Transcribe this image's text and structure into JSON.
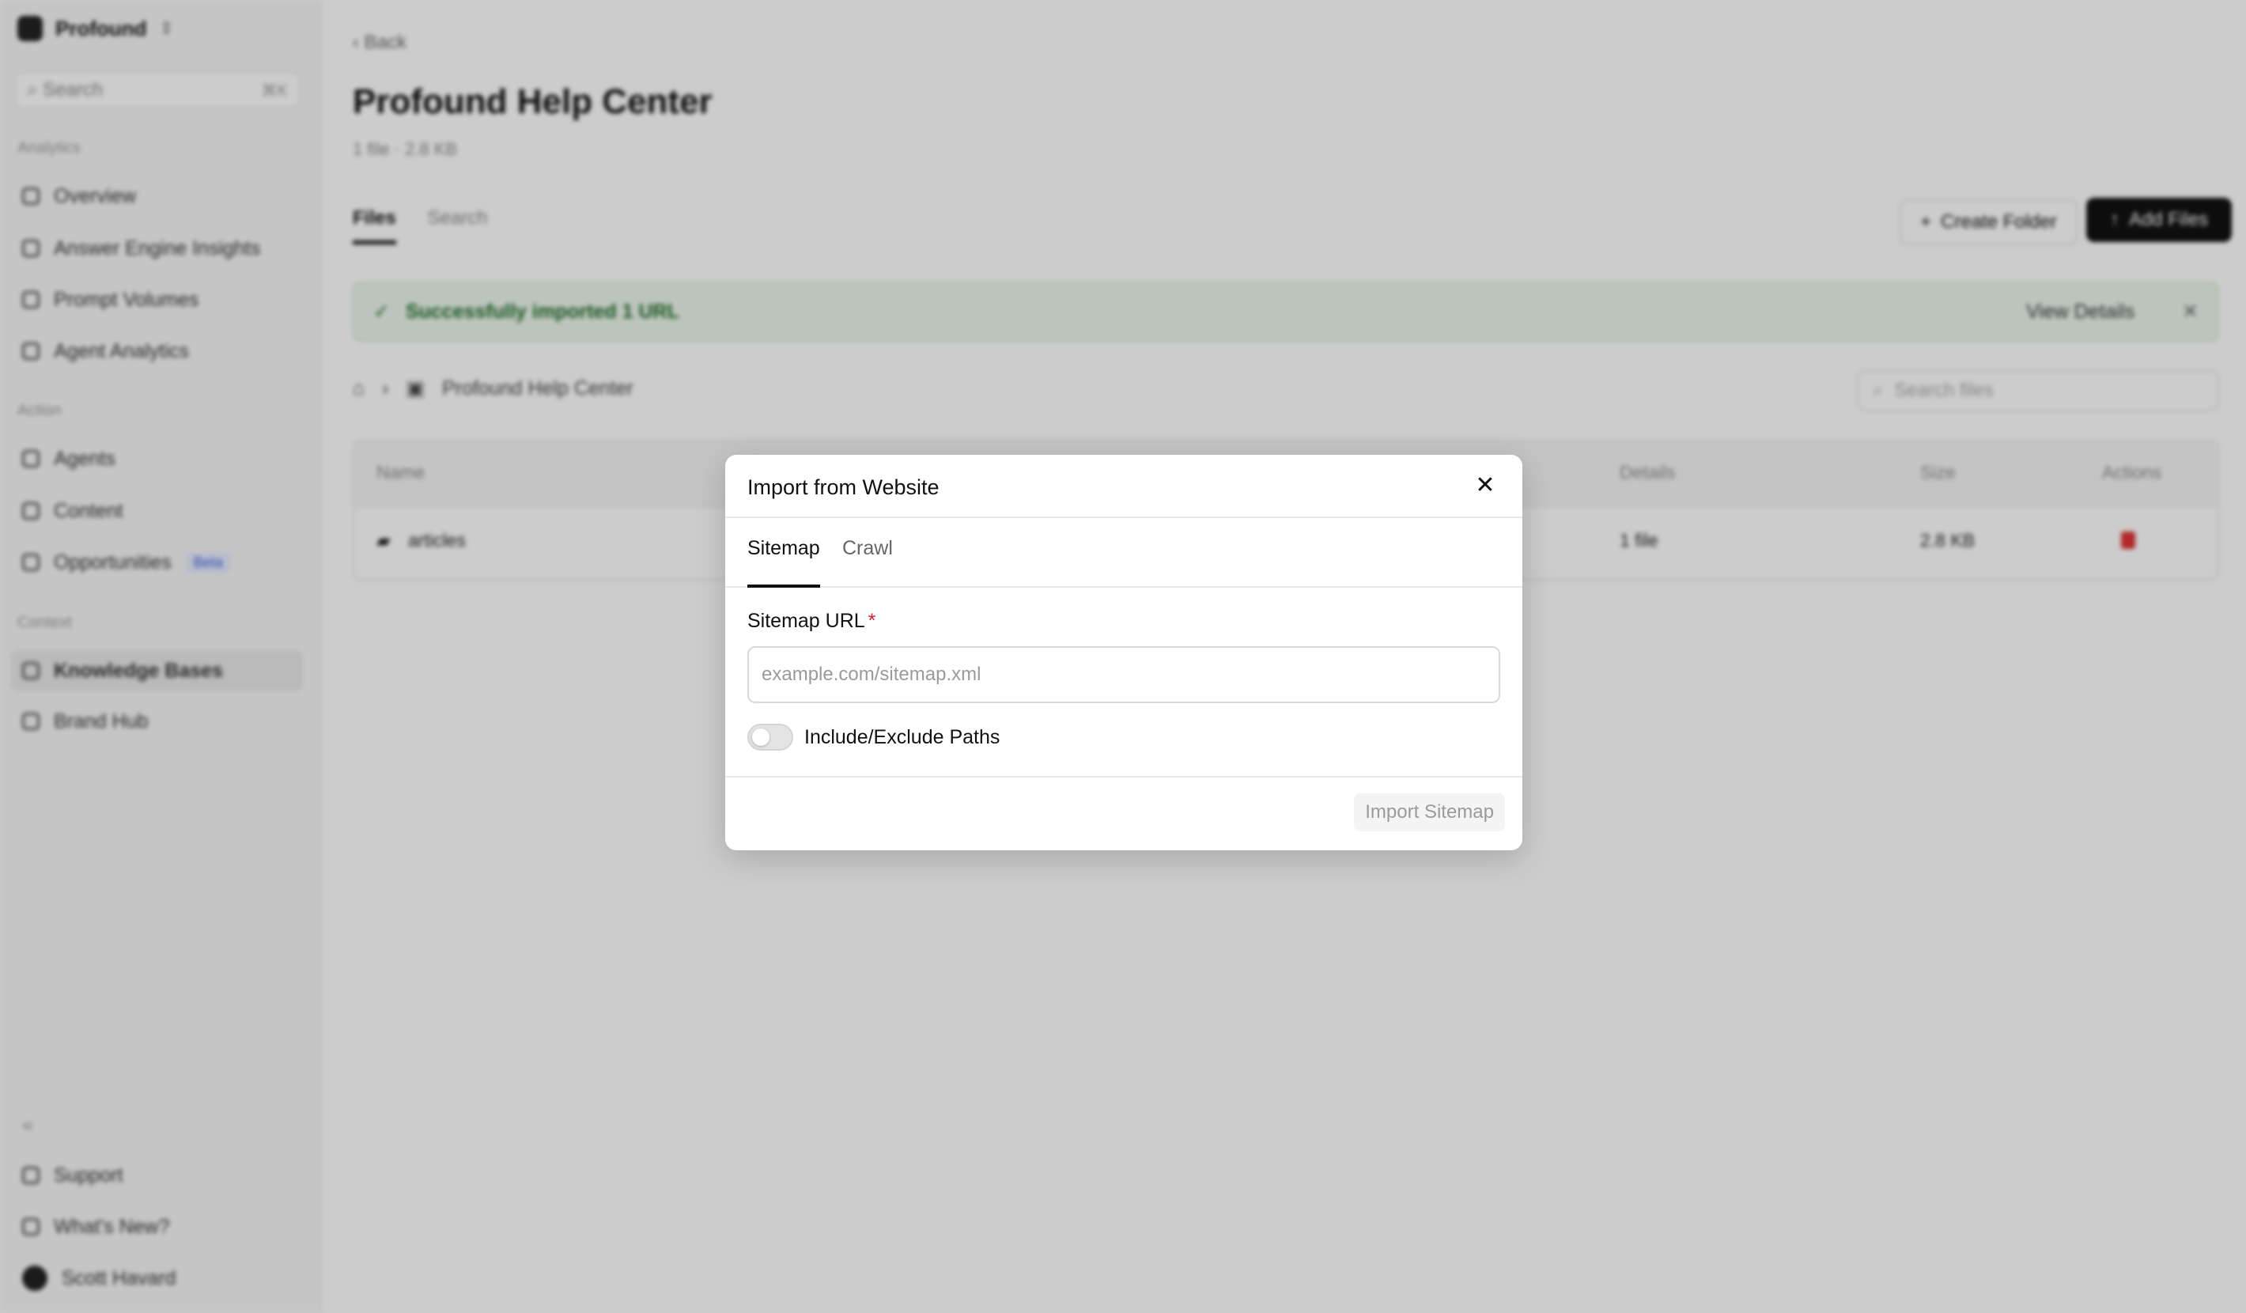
{
  "sidebar": {
    "org_name": "Profound",
    "search_placeholder": "Search",
    "search_shortcut": "⌘K",
    "sections": [
      {
        "label": "Analytics",
        "items": [
          "Overview",
          "Answer Engine Insights",
          "Prompt Volumes",
          "Agent Analytics"
        ]
      },
      {
        "label": "Action",
        "items": [
          "Agents",
          "Content",
          "Opportunities"
        ]
      },
      {
        "label": "Context",
        "items": [
          "Knowledge Bases",
          "Brand Hub"
        ]
      }
    ],
    "opportunities_badge": "Beta",
    "footer": {
      "collapse": "«",
      "support": "Support",
      "whats_new": "What's New?",
      "user": "Scott Havard"
    }
  },
  "main": {
    "back": "Back",
    "title": "Profound Help Center",
    "subtitle": "1 file · 2.8 KB",
    "tabs": [
      "Files",
      "Search"
    ],
    "create_folder": "Create Folder",
    "add_files": "Add Files",
    "banner": {
      "message": "Successfully imported 1 URL",
      "view_details": "View Details"
    },
    "breadcrumb": "Profound Help Center",
    "search_files_placeholder": "Search files",
    "table": {
      "headers": [
        "Name",
        "Details",
        "Size",
        "Actions"
      ],
      "rows": [
        {
          "name": "articles",
          "details": "1 file",
          "size": "2.8 KB"
        }
      ]
    }
  },
  "modal": {
    "title": "Import from Website",
    "tabs": [
      "Sitemap",
      "Crawl"
    ],
    "active_tab": "Sitemap",
    "field_label": "Sitemap URL",
    "required_marker": "*",
    "input_placeholder": "example.com/sitemap.xml",
    "input_value": "",
    "toggle_label": "Include/Exclude Paths",
    "toggle_on": false,
    "submit_label": "Import Sitemap",
    "close_glyph": "✕"
  }
}
